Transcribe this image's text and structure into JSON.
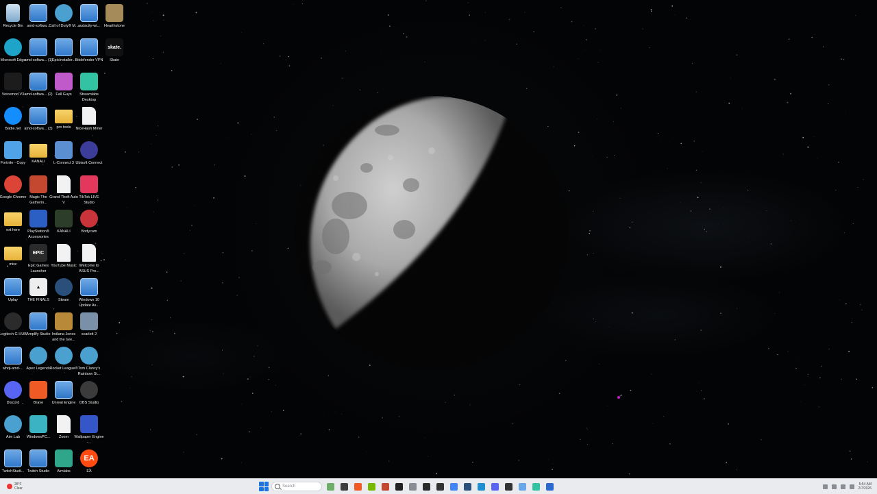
{
  "desktop": {
    "icons": [
      {
        "label": "Recycle Bin",
        "icon": "recycle-bin-icon",
        "color": "#8fb6d9",
        "shape": "bin"
      },
      {
        "label": "amd-softwa...",
        "icon": "installer-icon",
        "color": "#3a86d4",
        "shape": "file"
      },
      {
        "label": "Call of Duty® M...",
        "icon": "globe-icon",
        "color": "#4aa0cf",
        "shape": "circle"
      },
      {
        "label": "audacity-wi...",
        "icon": "installer-icon",
        "color": "#3a86d4",
        "shape": "file"
      },
      {
        "label": "Hearthstone",
        "icon": "hearthstone-icon",
        "color": "#a58a5a",
        "shape": "square"
      },
      {
        "label": "Microsoft Edge",
        "icon": "edge-icon",
        "color": "#1fa4c9",
        "shape": "circle"
      },
      {
        "label": "amd-softwa... (1)",
        "icon": "installer-icon",
        "color": "#3a86d4",
        "shape": "file"
      },
      {
        "label": "EpicInstaller...",
        "icon": "installer-icon",
        "color": "#3a86d4",
        "shape": "file"
      },
      {
        "label": "Bitdefender VPN",
        "icon": "installer-icon",
        "color": "#3a86d4",
        "shape": "file"
      },
      {
        "label": "Skate",
        "icon": "skate-icon",
        "color": "#111111",
        "shape": "text",
        "glyph": "skate."
      },
      {
        "label": "Voicemod V3",
        "icon": "voicemod-icon",
        "color": "#1c1c1c",
        "shape": "square"
      },
      {
        "label": "amd-softwa... (2)",
        "icon": "installer-icon",
        "color": "#3a86d4",
        "shape": "file"
      },
      {
        "label": "Fall Guys",
        "icon": "fall-guys-icon",
        "color": "#c05acb",
        "shape": "square"
      },
      {
        "label": "Streamlabs Desktop",
        "icon": "streamlabs-icon",
        "color": "#31c3a2",
        "shape": "square"
      },
      {
        "label": "",
        "icon": "blank-icon",
        "color": "transparent",
        "shape": "none"
      },
      {
        "label": "Battle.net",
        "icon": "battlenet-icon",
        "color": "#148eff",
        "shape": "circle"
      },
      {
        "label": "amd-softwa... (3)",
        "icon": "installer-icon",
        "color": "#3a86d4",
        "shape": "file"
      },
      {
        "label": "pro tools",
        "icon": "folder-icon",
        "color": "#f0c14b",
        "shape": "folder"
      },
      {
        "label": "NiceHash Miner",
        "icon": "document-icon",
        "color": "#f2f2f2",
        "shape": "doc"
      },
      {
        "label": "",
        "icon": "blank-icon",
        "color": "transparent",
        "shape": "none"
      },
      {
        "label": "Fortnite - Copy",
        "icon": "fortnite-icon",
        "color": "#4fa3e6",
        "shape": "square"
      },
      {
        "label": "KANALI",
        "icon": "folder-icon",
        "color": "#f0c14b",
        "shape": "folder"
      },
      {
        "label": "L-Connect 3",
        "icon": "lconnect-icon",
        "color": "#5a8fd1",
        "shape": "square"
      },
      {
        "label": "Ubisoft Connect",
        "icon": "ubisoft-icon",
        "color": "#3b3d99",
        "shape": "circle"
      },
      {
        "label": "",
        "icon": "blank-icon",
        "color": "transparent",
        "shape": "none"
      },
      {
        "label": "Google Chrome",
        "icon": "chrome-icon",
        "color": "#db4437",
        "shape": "circle"
      },
      {
        "label": "Magic The Gatherin...",
        "icon": "mtg-icon",
        "color": "#c4472f",
        "shape": "square"
      },
      {
        "label": "Grand Theft Auto V",
        "icon": "document-icon",
        "color": "#f2f2f2",
        "shape": "doc"
      },
      {
        "label": "TikTok LIVE Studio",
        "icon": "tiktok-icon",
        "color": "#e3385c",
        "shape": "square"
      },
      {
        "label": "",
        "icon": "blank-icon",
        "color": "transparent",
        "shape": "none"
      },
      {
        "label": "ext here",
        "icon": "folder-icon",
        "color": "#f0c14b",
        "shape": "folder"
      },
      {
        "label": "PlayStation® Accessories",
        "icon": "playstation-icon",
        "color": "#2b5fc4",
        "shape": "square"
      },
      {
        "label": "KANALI",
        "icon": "kanali-icon",
        "color": "#2c3e2a",
        "shape": "square"
      },
      {
        "label": "Bodycam",
        "icon": "bodycam-icon",
        "color": "#c9333a",
        "shape": "circle"
      },
      {
        "label": "",
        "icon": "blank-icon",
        "color": "transparent",
        "shape": "none"
      },
      {
        "label": "misc",
        "icon": "folder-icon",
        "color": "#f0c14b",
        "shape": "folder"
      },
      {
        "label": "Epic Games Launcher",
        "icon": "epic-games-icon",
        "color": "#2a2a2a",
        "shape": "text",
        "glyph": "EPIC"
      },
      {
        "label": "YouTube Music",
        "icon": "document-icon",
        "color": "#f2f2f2",
        "shape": "doc"
      },
      {
        "label": "Welcome to ASUS Pro...",
        "icon": "document-icon",
        "color": "#f2f2f2",
        "shape": "doc"
      },
      {
        "label": "",
        "icon": "blank-icon",
        "color": "transparent",
        "shape": "none"
      },
      {
        "label": "Uplay",
        "icon": "installer-icon",
        "color": "#3a86d4",
        "shape": "file"
      },
      {
        "label": "THE FINALS",
        "icon": "the-finals-icon",
        "color": "#eeeeee",
        "shape": "text",
        "glyph": "▲"
      },
      {
        "label": "Steam",
        "icon": "steam-icon",
        "color": "#2a4f7a",
        "shape": "circle"
      },
      {
        "label": "Windows 10 Update As...",
        "icon": "installer-icon",
        "color": "#3a86d4",
        "shape": "file"
      },
      {
        "label": "",
        "icon": "blank-icon",
        "color": "transparent",
        "shape": "none"
      },
      {
        "label": "Logitech G HUB",
        "icon": "logitech-icon",
        "color": "#2b2b2b",
        "shape": "circle"
      },
      {
        "label": "Amplify Studio",
        "icon": "installer-icon",
        "color": "#3a86d4",
        "shape": "file"
      },
      {
        "label": "Indiana Jones and the Gre...",
        "icon": "indiana-jones-icon",
        "color": "#b9893a",
        "shape": "square"
      },
      {
        "label": "scarlett 2",
        "icon": "scarlett-icon",
        "color": "#7a8fa8",
        "shape": "square"
      },
      {
        "label": "",
        "icon": "blank-icon",
        "color": "transparent",
        "shape": "none"
      },
      {
        "label": "whql-amd-...",
        "icon": "installer-icon",
        "color": "#3a86d4",
        "shape": "file"
      },
      {
        "label": "Apex Legends",
        "icon": "globe-icon",
        "color": "#4aa0cf",
        "shape": "circle"
      },
      {
        "label": "Rocket League®",
        "icon": "globe-icon",
        "color": "#4aa0cf",
        "shape": "circle"
      },
      {
        "label": "Tom Clancy's Rainbow Si...",
        "icon": "globe-icon",
        "color": "#4aa0cf",
        "shape": "circle"
      },
      {
        "label": "",
        "icon": "blank-icon",
        "color": "transparent",
        "shape": "none"
      },
      {
        "label": "Discord",
        "icon": "discord-icon",
        "color": "#5865f2",
        "shape": "circle"
      },
      {
        "label": "Brave",
        "icon": "brave-icon",
        "color": "#f05a24",
        "shape": "square"
      },
      {
        "label": "Unreal Engine",
        "icon": "installer-icon",
        "color": "#3a86d4",
        "shape": "file"
      },
      {
        "label": "OBS Studio",
        "icon": "obs-icon",
        "color": "#3b3b3b",
        "shape": "circle"
      },
      {
        "label": "",
        "icon": "blank-icon",
        "color": "transparent",
        "shape": "none"
      },
      {
        "label": "Aim Lab",
        "icon": "globe-icon",
        "color": "#4aa0cf",
        "shape": "circle"
      },
      {
        "label": "WindowsPC...",
        "icon": "windows-pc-icon",
        "color": "#3bb3c3",
        "shape": "square"
      },
      {
        "label": "Zoom",
        "icon": "document-icon",
        "color": "#f2f2f2",
        "shape": "doc"
      },
      {
        "label": "Wallpaper Engine -...",
        "icon": "wallpaper-engine-icon",
        "color": "#3456c8",
        "shape": "square"
      },
      {
        "label": "",
        "icon": "blank-icon",
        "color": "transparent",
        "shape": "none"
      },
      {
        "label": "TwitchStudi...",
        "icon": "installer-icon",
        "color": "#3a86d4",
        "shape": "file"
      },
      {
        "label": "Twitch Studio",
        "icon": "installer-icon",
        "color": "#3a86d4",
        "shape": "file"
      },
      {
        "label": "Aimlabs",
        "icon": "aimlabs-icon",
        "color": "#2fa58a",
        "shape": "square"
      },
      {
        "label": "EA",
        "icon": "ea-icon",
        "color": "#ff4a12",
        "shape": "circle",
        "glyph": "EA"
      },
      {
        "label": "",
        "icon": "blank-icon",
        "color": "transparent",
        "shape": "none"
      }
    ]
  },
  "taskbar": {
    "weather": {
      "temp": "28°F",
      "condition": "Clear"
    },
    "search_placeholder": "Search",
    "apps": [
      {
        "icon": "widgets-icon",
        "color": "#6fae6a"
      },
      {
        "icon": "file-explorer-icon",
        "color": "#3d3d3d"
      },
      {
        "icon": "brave-icon",
        "color": "#f05a24"
      },
      {
        "icon": "nvidia-icon",
        "color": "#76b900"
      },
      {
        "icon": "app-icon",
        "color": "#c4472f"
      },
      {
        "icon": "terminal-icon",
        "color": "#222222"
      },
      {
        "icon": "settings-icon",
        "color": "#8a8d93"
      },
      {
        "icon": "logitech-icon",
        "color": "#2b2b2b"
      },
      {
        "icon": "app-icon",
        "color": "#333333"
      },
      {
        "icon": "chrome-icon",
        "color": "#4285f4"
      },
      {
        "icon": "steam-icon",
        "color": "#2a4f7a"
      },
      {
        "icon": "edge-icon",
        "color": "#1f8fd0"
      },
      {
        "icon": "discord-icon",
        "color": "#5865f2"
      },
      {
        "icon": "app-icon",
        "color": "#333333"
      },
      {
        "icon": "copilot-icon",
        "color": "#6aa7e8"
      },
      {
        "icon": "streamlabs-icon",
        "color": "#31c3a2"
      },
      {
        "icon": "app-icon",
        "color": "#2a6ad0"
      }
    ],
    "clock": {
      "time": "5:54 AM",
      "date": "2/7/2026"
    }
  }
}
